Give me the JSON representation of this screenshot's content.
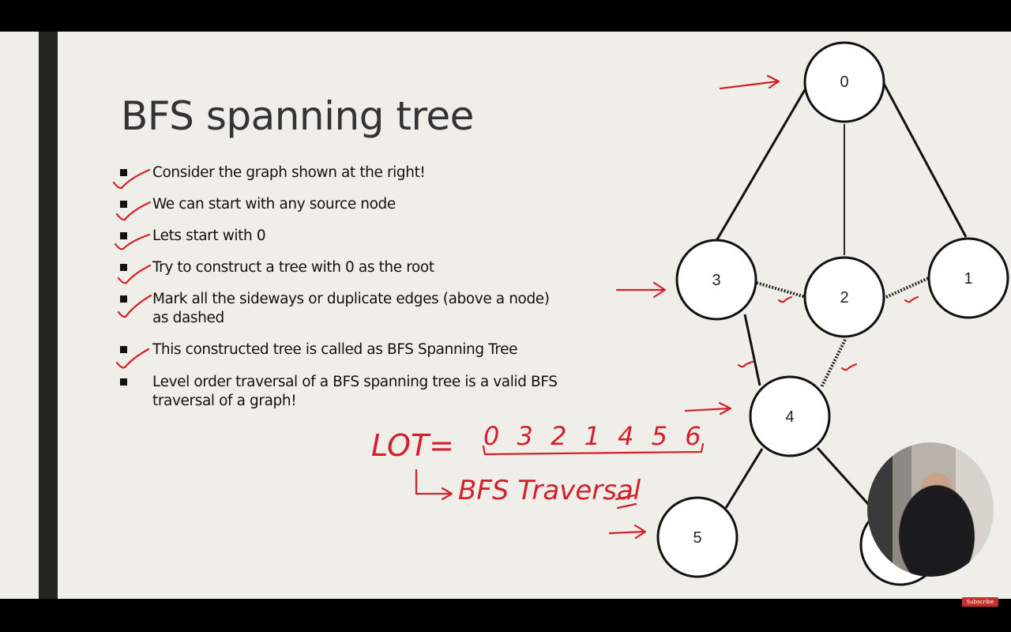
{
  "slide": {
    "title": "BFS spanning tree",
    "bullets": [
      "Consider the graph shown at the right!",
      "We can start with any source node",
      "Lets start with 0",
      "Try to construct a tree with 0 as the root",
      "Mark all the sideways or duplicate edges (above a node) as dashed",
      "This constructed tree is called as BFS Spanning Tree",
      "Level order traversal of a BFS spanning tree is a valid BFS traversal of a graph!"
    ]
  },
  "graph": {
    "nodes": [
      "0",
      "3",
      "2",
      "1",
      "4",
      "5",
      "6"
    ],
    "tree_edges": [
      [
        "0",
        "3"
      ],
      [
        "0",
        "2"
      ],
      [
        "0",
        "1"
      ],
      [
        "3",
        "4"
      ],
      [
        "4",
        "5"
      ],
      [
        "4",
        "6"
      ]
    ],
    "dashed_edges": [
      [
        "3",
        "2"
      ],
      [
        "2",
        "1"
      ],
      [
        "2",
        "4"
      ]
    ]
  },
  "annotations": {
    "lot_label": "LOT=",
    "lot_sequence": "0 3 2 1 4 5 6",
    "bfs_note": "BFS Traversal",
    "ink_color": "#d4202a"
  },
  "overlay": {
    "subscribe_label": "Subscribe"
  }
}
